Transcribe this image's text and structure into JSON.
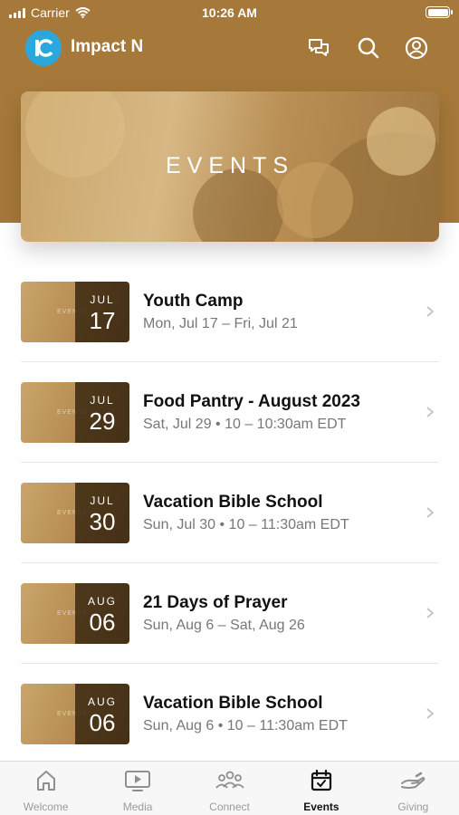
{
  "status_bar": {
    "carrier": "Carrier",
    "time": "10:26 AM"
  },
  "header": {
    "app_name": "Impact N"
  },
  "banner": {
    "title": "EVENTS"
  },
  "events": [
    {
      "month": "JUL",
      "day": "17",
      "title": "Youth Camp",
      "subtitle": "Mon, Jul 17 – Fri, Jul 21",
      "thumb_text": "EVENTS"
    },
    {
      "month": "JUL",
      "day": "29",
      "title": "Food Pantry - August 2023",
      "subtitle": "Sat, Jul 29 • 10 – 10:30am EDT",
      "thumb_text": "EVENTS"
    },
    {
      "month": "JUL",
      "day": "30",
      "title": "Vacation Bible School",
      "subtitle": "Sun, Jul 30 • 10 – 11:30am EDT",
      "thumb_text": "EVENTS"
    },
    {
      "month": "AUG",
      "day": "06",
      "title": "21 Days of Prayer",
      "subtitle": "Sun, Aug 6 – Sat, Aug 26",
      "thumb_text": "EVENTS"
    },
    {
      "month": "AUG",
      "day": "06",
      "title": "Vacation Bible School",
      "subtitle": "Sun, Aug 6 • 10 – 11:30am EDT",
      "thumb_text": "EVENTS"
    }
  ],
  "tabs": [
    {
      "label": "Welcome",
      "icon": "home-icon"
    },
    {
      "label": "Media",
      "icon": "media-icon"
    },
    {
      "label": "Connect",
      "icon": "people-icon"
    },
    {
      "label": "Events",
      "icon": "calendar-icon",
      "active": true
    },
    {
      "label": "Giving",
      "icon": "giving-hand-icon"
    }
  ],
  "colors": {
    "brand_gold": "#a6793a",
    "logo_blue": "#2aa8de"
  }
}
